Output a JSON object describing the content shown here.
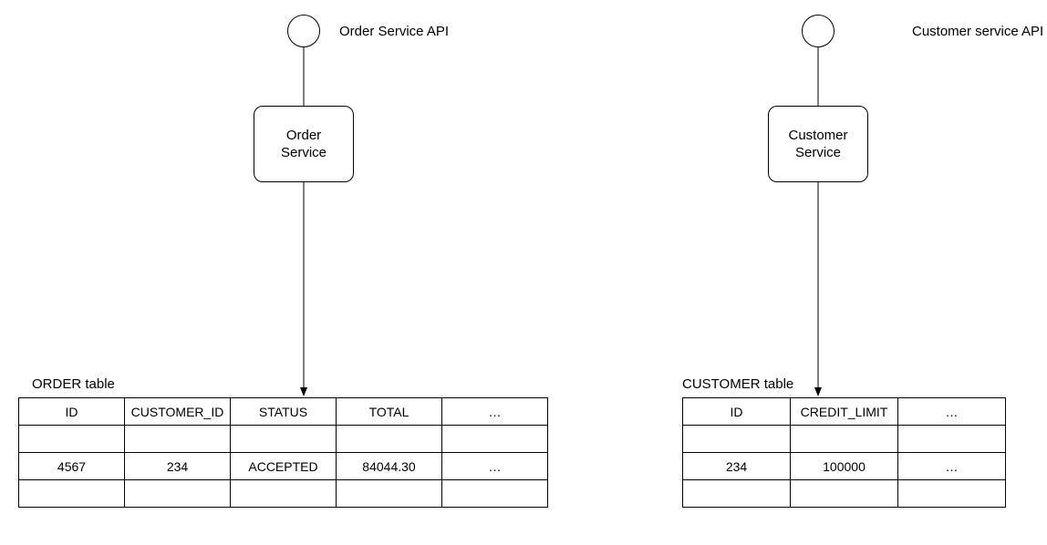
{
  "left": {
    "api_label": "Order Service API",
    "service_label": "Order\nService",
    "table_label": "ORDER table",
    "columns": [
      "ID",
      "CUSTOMER_ID",
      "STATUS",
      "TOTAL",
      "…"
    ],
    "rows": [
      [
        "",
        "",
        "",
        "",
        ""
      ],
      [
        "4567",
        "234",
        "ACCEPTED",
        "84044.30",
        "…"
      ],
      [
        "",
        "",
        "",
        "",
        ""
      ]
    ]
  },
  "right": {
    "api_label": "Customer service API",
    "service_label": "Customer\nService",
    "table_label": "CUSTOMER table",
    "columns": [
      "ID",
      "CREDIT_LIMIT",
      "…"
    ],
    "rows": [
      [
        "",
        "",
        ""
      ],
      [
        "234",
        "100000",
        "…"
      ],
      [
        "",
        "",
        ""
      ]
    ]
  }
}
